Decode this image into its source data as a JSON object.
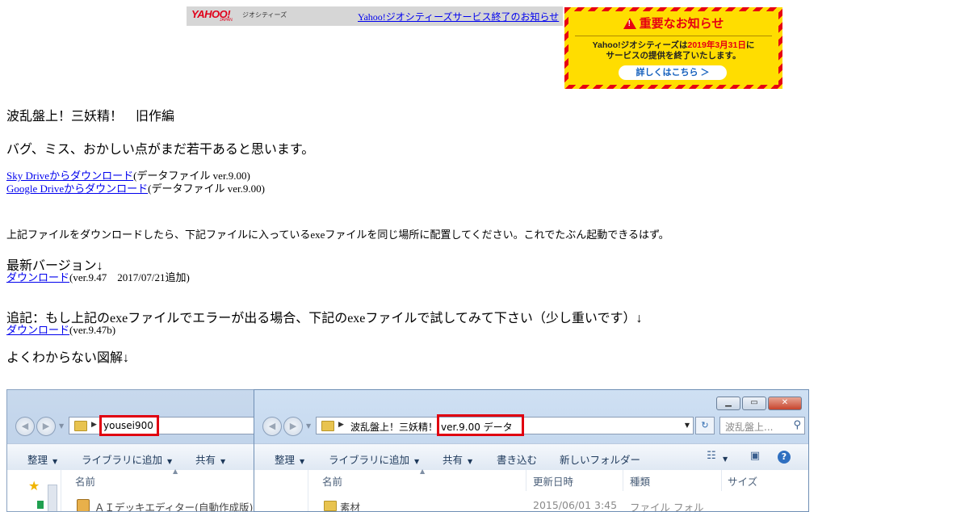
{
  "yahoo_bar": {
    "logo": "YAHOO!",
    "logo_sub": "JAPAN",
    "service": "ジオシティーズ",
    "link": "Yahoo!ジオシティーズサービス終了のお知らせ"
  },
  "notice": {
    "title": "重要なお知らせ",
    "line1_a": "Yahoo!ジオシティーズは",
    "line1_date": "2019年3月31日",
    "line1_b": "に",
    "line2": "サービスの提供を終了いたします。",
    "button": "詳しくはこちら ＞"
  },
  "page": {
    "title": "波乱盤上！三妖精！　旧作編",
    "bug_note": "バグ、ミス、おかしい点がまだ若干あると思います。",
    "dl1_link": "Sky Driveからダウンロード",
    "dl1_suffix": "(データファイル ver.9.00)",
    "dl2_link": "Google Driveからダウンロード",
    "dl2_suffix": "(データファイル ver.9.00)",
    "instructions": "上記ファイルをダウンロードしたら、下記ファイルに入っているexeファイルを同じ場所に配置してください。これでたぶん起動できるはず。",
    "latest_heading": "最新バージョン↓",
    "latest_link": "ダウンロード",
    "latest_suffix": "(ver.9.47　2017/07/21追加)",
    "addendum": "追記：もし上記のexeファイルでエラーが出る場合、下記のexeファイルで試してみて下さい（少し重いです）↓",
    "alt_link": "ダウンロード",
    "alt_suffix": "(ver.9.47b)",
    "diagram_heading": "よくわからない図解↓"
  },
  "explorer_left": {
    "path_folder": "yousei900",
    "toolbar": [
      "整理",
      "ライブラリに追加",
      "共有"
    ],
    "column_name": "名前",
    "file_row": "ＡＩデッキエディター(自動作成版)ver"
  },
  "explorer_right": {
    "path_parent": "波乱盤上！三妖精！",
    "path_folder": "ver.9.00 データ",
    "search_placeholder": "波乱盤上...",
    "toolbar": [
      "整理",
      "ライブラリに追加",
      "共有",
      "書き込む",
      "新しいフォルダー"
    ],
    "columns": [
      "名前",
      "更新日時",
      "種類",
      "サイズ"
    ],
    "row": {
      "name": "素材",
      "date": "2015/06/01 3:45",
      "type": "ファイル フォル"
    }
  },
  "colors": {
    "link": "#0000ee",
    "highlight": "#e00010",
    "notice_bg": "#ffdd00",
    "notice_red": "#e60012"
  }
}
